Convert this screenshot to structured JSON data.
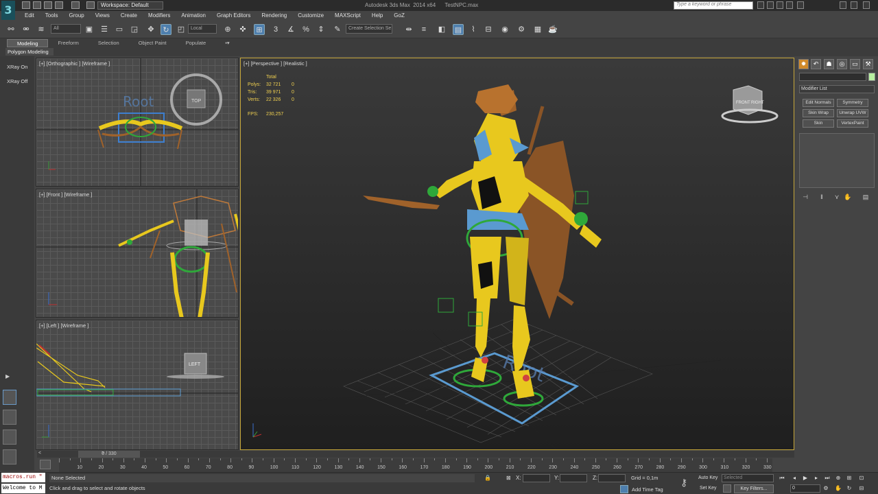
{
  "title_bar": {
    "workspace": "Workspace: Default",
    "window_title": "Autodesk 3ds Max  2014 x64      TestNPC.max",
    "search_placeholder": "Type a keyword or phrase"
  },
  "menu": [
    "Edit",
    "Tools",
    "Group",
    "Views",
    "Create",
    "Modifiers",
    "Animation",
    "Graph Editors",
    "Rendering",
    "Customize",
    "MAXScript",
    "Help",
    "GoZ"
  ],
  "toolbar": {
    "filter_value": "All",
    "coord_system": "Local",
    "selection_set_placeholder": "Create Selection Se"
  },
  "ribbon": {
    "tabs": [
      "Modeling",
      "Freeform",
      "Selection",
      "Object Paint",
      "Populate"
    ],
    "active_tab": "Modeling",
    "panel_label": "Polygon Modeling"
  },
  "left_panel": {
    "xray_on": "XRay On",
    "xray_off": "XRay Off"
  },
  "viewports": {
    "top": {
      "label": "[+] [Orthographic ] [Wireframe ]",
      "cube_label": "TOP"
    },
    "front": {
      "label": "[+] [Front ] [Wireframe ]"
    },
    "left": {
      "label": "[+] [Left ] [Wireframe ]",
      "cube_label": "LEFT"
    },
    "perspective": {
      "label": "[+] [Perspective ] [Realistic ]",
      "cube_front": "FRONT",
      "cube_right": "RIGHT",
      "root_text": "Root"
    }
  },
  "stats": {
    "header": "Total",
    "rows": [
      {
        "key": "Polys:",
        "total": "32 721",
        "sel": "0"
      },
      {
        "key": "Tris:",
        "total": "39 971",
        "sel": "0"
      },
      {
        "key": "Verts:",
        "total": "22 326",
        "sel": "0"
      }
    ],
    "fps_label": "FPS:",
    "fps_value": "230,257"
  },
  "command_panel": {
    "modifier_list": "Modifier List",
    "modifiers": [
      "Edit Normals",
      "Symmetry",
      "Skin Wrap",
      "Unwrap UVW",
      "Skin",
      "VertexPaint"
    ]
  },
  "timeline": {
    "frame_label": "0 / 330",
    "ticks": [
      "10",
      "20",
      "30",
      "40",
      "50",
      "60",
      "70",
      "80",
      "90",
      "100",
      "110",
      "120",
      "130",
      "140",
      "150",
      "160",
      "170",
      "180",
      "190",
      "200",
      "210",
      "220",
      "230",
      "240",
      "250",
      "260",
      "270",
      "280",
      "290",
      "300",
      "310",
      "320",
      "330"
    ]
  },
  "status": {
    "maxscript_line1": "macros.run \"",
    "maxscript_line2": "Welcome to M",
    "selection": "None Selected",
    "prompt": "Click and drag to select and rotate objects",
    "x_label": "X:",
    "y_label": "Y:",
    "z_label": "Z:",
    "grid": "Grid = 0,1m",
    "add_time_tag": "Add Time Tag",
    "auto_key": "Auto Key",
    "set_key": "Set Key",
    "selected": "Selected",
    "key_filters": "Key Filters...",
    "current_frame": "0"
  },
  "colors": {
    "accent": "#4e7fae",
    "viewport_border_active": "#c8a83a",
    "stats_text": "#f0d050",
    "armor_yellow": "#e8c81e",
    "armor_brown": "#a0622a",
    "armor_blue": "#5a9ad0",
    "rig_green": "#2fa83a"
  }
}
